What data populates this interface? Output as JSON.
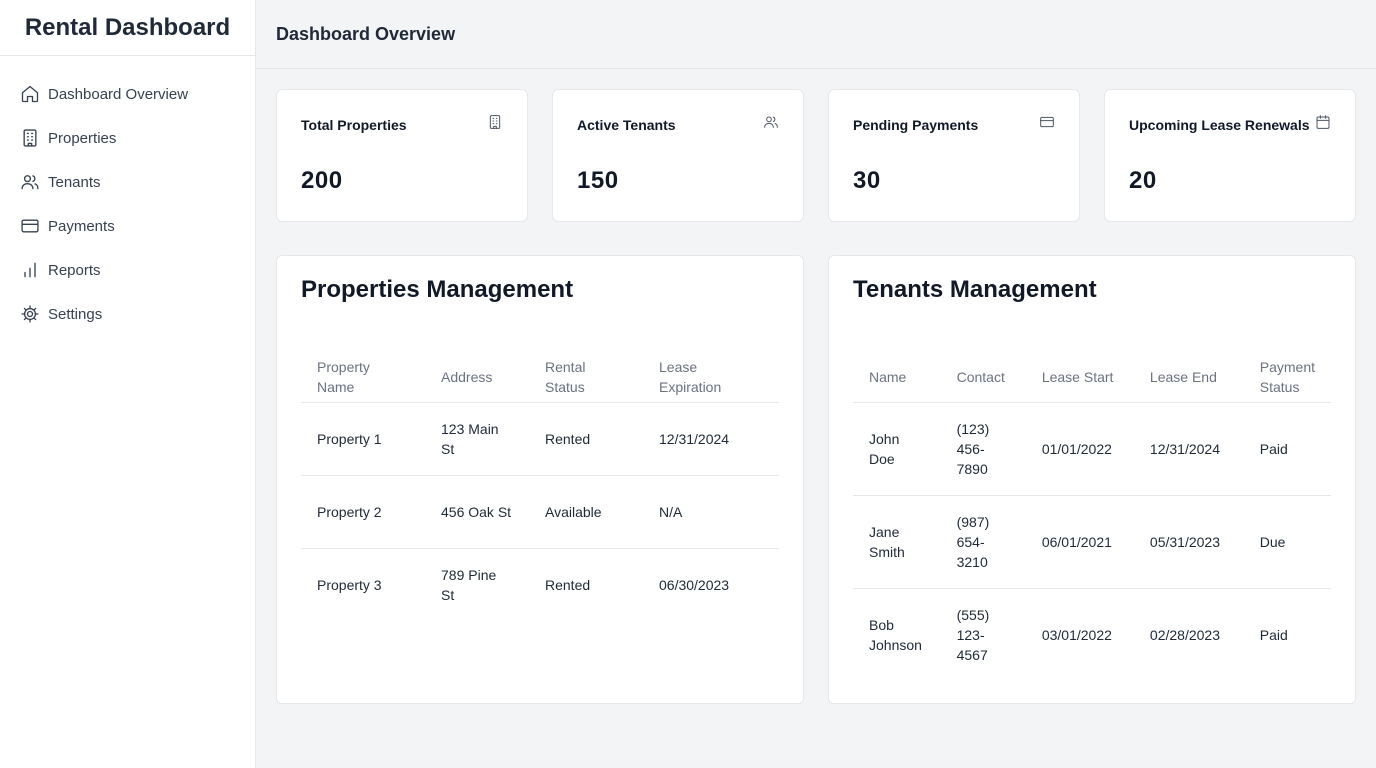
{
  "sidebar": {
    "title": "Rental Dashboard",
    "items": [
      {
        "label": "Dashboard Overview",
        "icon": "home-icon"
      },
      {
        "label": "Properties",
        "icon": "building-icon"
      },
      {
        "label": "Tenants",
        "icon": "users-icon"
      },
      {
        "label": "Payments",
        "icon": "credit-card-icon"
      },
      {
        "label": "Reports",
        "icon": "bar-chart-icon"
      },
      {
        "label": "Settings",
        "icon": "gear-icon"
      }
    ]
  },
  "header": {
    "title": "Dashboard Overview"
  },
  "stats": [
    {
      "title": "Total Properties",
      "value": "200",
      "icon": "building-icon"
    },
    {
      "title": "Active Tenants",
      "value": "150",
      "icon": "users-icon"
    },
    {
      "title": "Pending Payments",
      "value": "30",
      "icon": "credit-card-icon"
    },
    {
      "title": "Upcoming Lease Renewals",
      "value": "20",
      "icon": "calendar-icon"
    }
  ],
  "properties": {
    "title": "Properties Management",
    "columns": [
      "Property Name",
      "Address",
      "Rental Status",
      "Lease Expiration"
    ],
    "rows": [
      [
        "Property 1",
        "123 Main St",
        "Rented",
        "12/31/2024"
      ],
      [
        "Property 2",
        "456 Oak St",
        "Available",
        "N/A"
      ],
      [
        "Property 3",
        "789 Pine St",
        "Rented",
        "06/30/2023"
      ]
    ]
  },
  "tenants": {
    "title": "Tenants Management",
    "columns": [
      "Name",
      "Contact",
      "Lease Start",
      "Lease End",
      "Payment Status"
    ],
    "rows": [
      [
        "John Doe",
        "(123) 456-7890",
        "01/01/2022",
        "12/31/2024",
        "Paid"
      ],
      [
        "Jane Smith",
        "(987) 654-3210",
        "06/01/2021",
        "05/31/2023",
        "Due"
      ],
      [
        "Bob Johnson",
        "(555) 123-4567",
        "03/01/2022",
        "02/28/2023",
        "Paid"
      ]
    ]
  },
  "colors": {
    "background": "#f3f4f6",
    "card": "#ffffff",
    "border": "#e5e7eb",
    "text": "#111827",
    "muted": "#6b7280"
  }
}
